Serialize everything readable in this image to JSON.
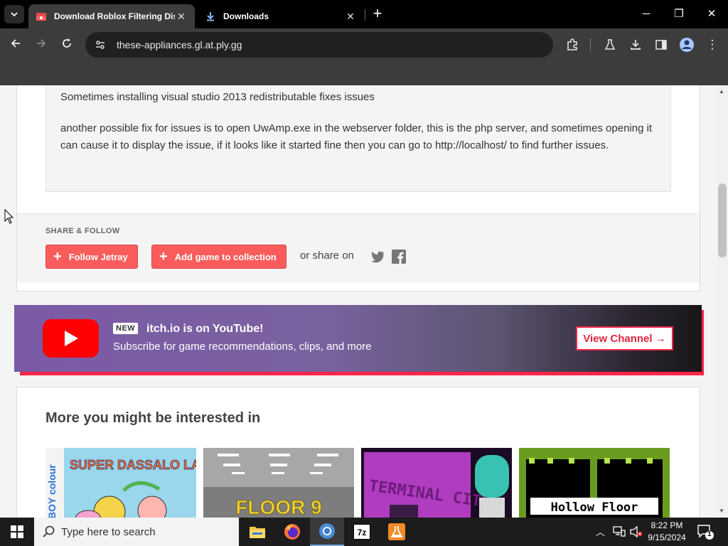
{
  "browser": {
    "tabs": [
      {
        "title": "Download Roblox Filtering Dis",
        "active": true
      },
      {
        "title": "Downloads",
        "active": false
      }
    ],
    "url": "these-appliances.gl.at.ply.gg"
  },
  "page": {
    "note_paragraphs": [
      "Sometimes installing visual studio 2013 redistributable fixes issues",
      "another possible fix for issues is to open UwAmp.exe in the webserver folder, this is the php server, and sometimes opening it can cause it to display the issue, if it looks like it started fine then you can go to http://localhost/ to find further issues."
    ],
    "share": {
      "heading": "SHARE & FOLLOW",
      "follow_label": "Follow Jetray",
      "collection_label": "Add game to collection",
      "share_on": "or share on"
    },
    "youtube": {
      "badge": "NEW",
      "title": "itch.io is on YouTube!",
      "subtitle": "Subscribe for game recommendations, clips, and more",
      "button": "View Channel →"
    },
    "more": {
      "heading": "More you might be interested in",
      "games": [
        {
          "caption": "SUPER DASSALO LAND",
          "side": "BOY colour",
          "bg": "#8ed0e8"
        },
        {
          "caption": "FLOOR 9",
          "bg": "#9a9a9a"
        },
        {
          "caption": "TERMINAL CITY",
          "bg": "#9b2fa6"
        },
        {
          "caption": "Hollow Floor",
          "bg": "#000000"
        }
      ]
    }
  },
  "taskbar": {
    "search_placeholder": "Type here to search",
    "time": "8:22 PM",
    "date": "9/15/2024",
    "notification_count": "1"
  },
  "colors": {
    "accent_red": "#fa5c5c",
    "yt_red": "#ff0000",
    "itch_pink": "#ff2449"
  }
}
